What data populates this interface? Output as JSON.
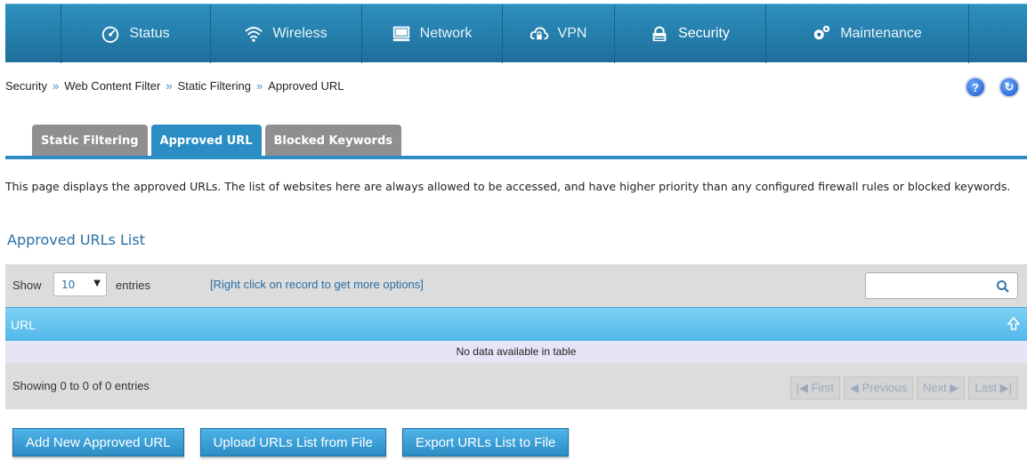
{
  "nav": {
    "items": [
      {
        "label": "Status",
        "icon": "dashboard-icon"
      },
      {
        "label": "Wireless",
        "icon": "wifi-icon"
      },
      {
        "label": "Network",
        "icon": "monitor-icon"
      },
      {
        "label": "VPN",
        "icon": "cloud-lock-icon"
      },
      {
        "label": "Security",
        "icon": "lock-icon",
        "active": true
      },
      {
        "label": "Maintenance",
        "icon": "gears-icon"
      }
    ]
  },
  "breadcrumb": {
    "parts": [
      "Security",
      "Web Content Filter",
      "Static Filtering",
      "Approved URL"
    ],
    "separator": "»"
  },
  "help": {
    "help_label": "?",
    "logout_label": "↻"
  },
  "tabs": [
    {
      "label": "Static Filtering",
      "active": false
    },
    {
      "label": "Approved URL",
      "active": true
    },
    {
      "label": "Blocked Keywords",
      "active": false
    }
  ],
  "description": "This page displays the approved URLs. The list of websites here are always allowed to be accessed, and have higher priority than any configured firewall rules or blocked keywords.",
  "section_title": "Approved URLs List",
  "table": {
    "show_label": "Show",
    "show_value": "10",
    "entries_label": "entries",
    "hint": "[Right click on record to get more options]",
    "search_placeholder": "",
    "column_header": "URL",
    "empty_text": "No data available in table",
    "info_text": "Showing 0 to 0 of 0 entries",
    "pager": {
      "first": "First",
      "previous": "Previous",
      "next": "Next",
      "last": "Last"
    }
  },
  "actions": {
    "add": "Add New Approved URL",
    "upload": "Upload URLs List from File",
    "export": "Export URLs List to File"
  },
  "colors": {
    "nav": "#2a86b8",
    "accent": "#2a8ec4",
    "header": "#6cc6f0"
  }
}
